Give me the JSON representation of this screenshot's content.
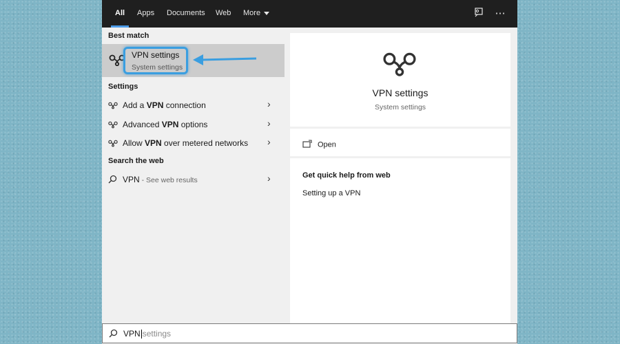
{
  "tabs": [
    {
      "label": "All",
      "active": true
    },
    {
      "label": "Apps",
      "active": false
    },
    {
      "label": "Documents",
      "active": false
    },
    {
      "label": "Web",
      "active": false
    },
    {
      "label": "More",
      "active": false
    }
  ],
  "topbar_icons": [
    "feedback-icon",
    "more-options-icon"
  ],
  "best_match": {
    "heading": "Best match",
    "title": "VPN settings",
    "subtitle": "System settings"
  },
  "settings": {
    "heading": "Settings",
    "items": [
      {
        "pre": "Add a ",
        "bold": "VPN",
        "post": " connection"
      },
      {
        "pre": "Advanced ",
        "bold": "VPN",
        "post": " options"
      },
      {
        "pre": "Allow ",
        "bold": "VPN",
        "post": " over metered networks"
      }
    ]
  },
  "web": {
    "heading": "Search the web",
    "item": {
      "query": "VPN",
      "suffix": " - See web results"
    }
  },
  "detail": {
    "title": "VPN settings",
    "subtitle": "System settings",
    "open_label": "Open",
    "help_heading": "Get quick help from web",
    "help_link": "Setting up a VPN"
  },
  "search": {
    "typed": "VPN",
    "suggestion": "settings"
  },
  "colors": {
    "accent": "#3a9ee0",
    "topbar": "#1f1f1f",
    "selected_row": "#cccccc"
  }
}
